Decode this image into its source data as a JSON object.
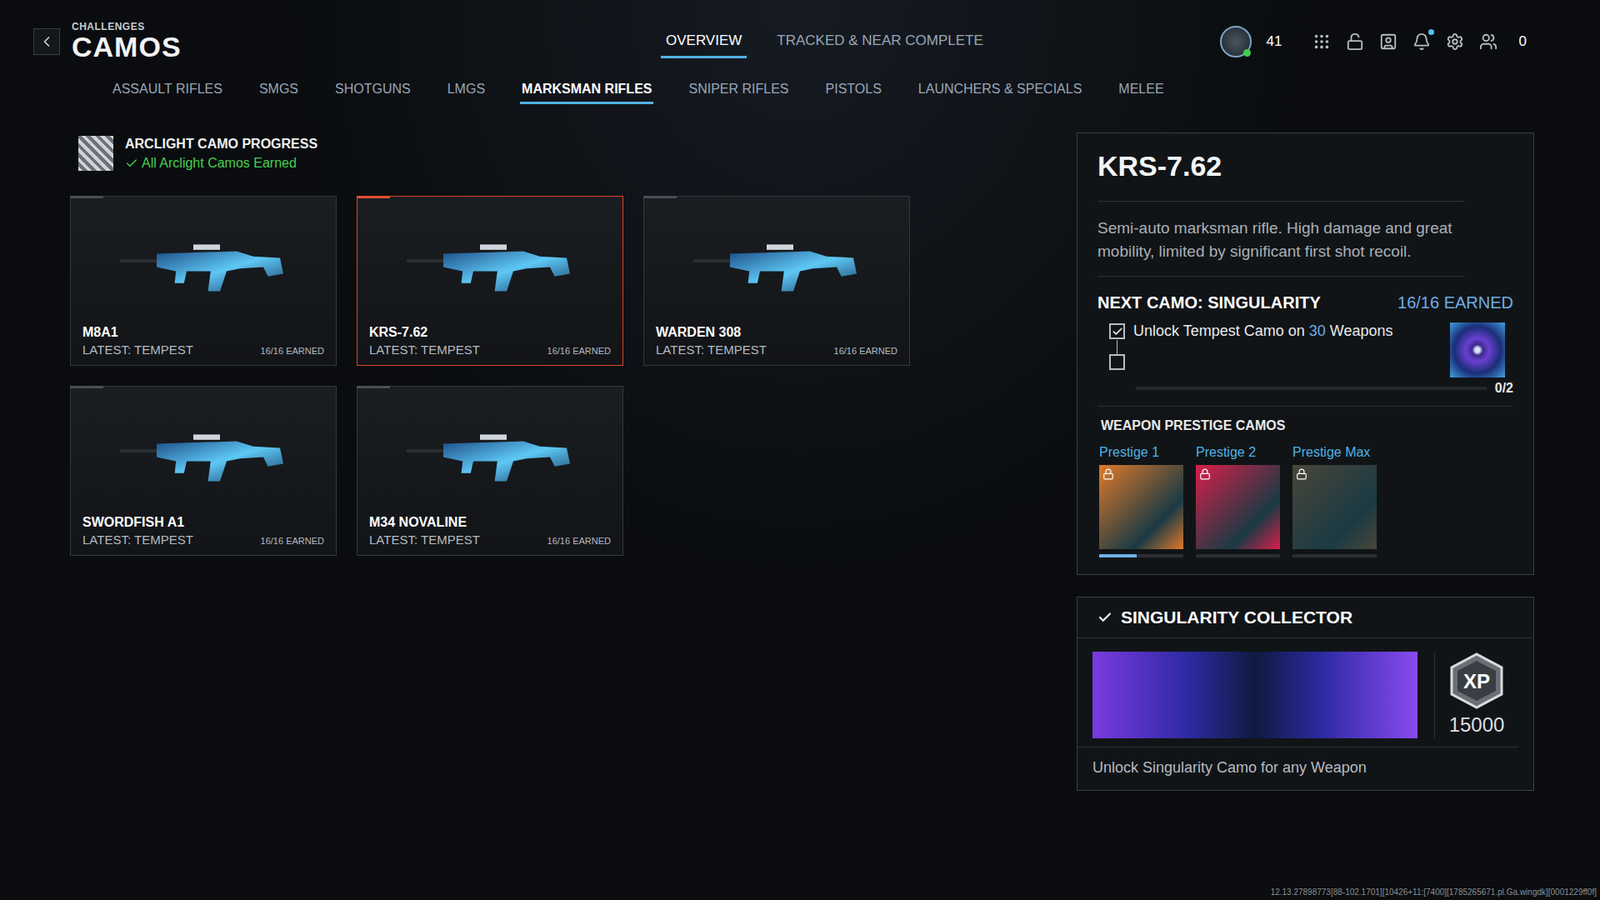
{
  "header": {
    "eyebrow": "CHALLENGES",
    "title": "CAMOS"
  },
  "nav_tabs": [
    {
      "label": "OVERVIEW",
      "selected": true
    },
    {
      "label": "TRACKED & NEAR COMPLETE",
      "selected": false
    }
  ],
  "top_bar": {
    "level": "41",
    "notification": true,
    "count": "0"
  },
  "category_tabs": [
    {
      "label": "ASSAULT RIFLES",
      "selected": false
    },
    {
      "label": "SMGS",
      "selected": false
    },
    {
      "label": "SHOTGUNS",
      "selected": false
    },
    {
      "label": "LMGS",
      "selected": false
    },
    {
      "label": "MARKSMAN RIFLES",
      "selected": true
    },
    {
      "label": "SNIPER RIFLES",
      "selected": false
    },
    {
      "label": "PISTOLS",
      "selected": false
    },
    {
      "label": "LAUNCHERS & SPECIALS",
      "selected": false
    },
    {
      "label": "MELEE",
      "selected": false
    }
  ],
  "progress": {
    "title": "ARCLIGHT CAMO PROGRESS",
    "status": "All Arclight Camos Earned",
    "complete": true
  },
  "weapons": [
    {
      "name": "M8A1",
      "latest": "LATEST: TEMPEST",
      "earned": "16/16 EARNED",
      "selected": false
    },
    {
      "name": "KRS-7.62",
      "latest": "LATEST: TEMPEST",
      "earned": "16/16 EARNED",
      "selected": true
    },
    {
      "name": "WARDEN 308",
      "latest": "LATEST: TEMPEST",
      "earned": "16/16 EARNED",
      "selected": false
    },
    {
      "name": "SWORDFISH A1",
      "latest": "LATEST: TEMPEST",
      "earned": "16/16 EARNED",
      "selected": false
    },
    {
      "name": "M34 NOVALINE",
      "latest": "LATEST: TEMPEST",
      "earned": "16/16 EARNED",
      "selected": false
    }
  ],
  "detail": {
    "name": "KRS-7.62",
    "description": "Semi-auto marksman rifle. High damage and great mobility, limited by significant first shot recoil.",
    "next_camo": "NEXT CAMO: SINGULARITY",
    "earned": "16/16 EARNED",
    "tasks": [
      {
        "parts": [
          {
            "text": "Unlock Tempest Camo on ",
            "highlight": false
          },
          {
            "text": "30",
            "highlight": true
          },
          {
            "text": " Weapons",
            "highlight": false
          }
        ],
        "checked": true
      },
      {
        "parts": [],
        "checked": false
      }
    ],
    "task_progress": "0/2",
    "task_level": 0,
    "prestige_title": "WEAPON PRESTIGE CAMOS",
    "prestige": [
      {
        "label": "Prestige 1",
        "locked": true,
        "level": 0.45,
        "color": "#e07a2a"
      },
      {
        "label": "Prestige 2",
        "locked": true,
        "level": 0,
        "color": "#d81f4a"
      },
      {
        "label": "Prestige Max",
        "locked": true,
        "level": 0,
        "color": "#4a4638"
      }
    ]
  },
  "collector": {
    "title": "SINGULARITY COLLECTOR",
    "checked": true,
    "xp_label": "XP",
    "xp": "15000",
    "description": "Unlock Singularity Camo for any Weapon"
  },
  "footer": {
    "version": "12.13.27898773[88-102.1701][10426+11:[7400][1785265671.pl.Ga.wingdk][0001229ff0f]"
  }
}
